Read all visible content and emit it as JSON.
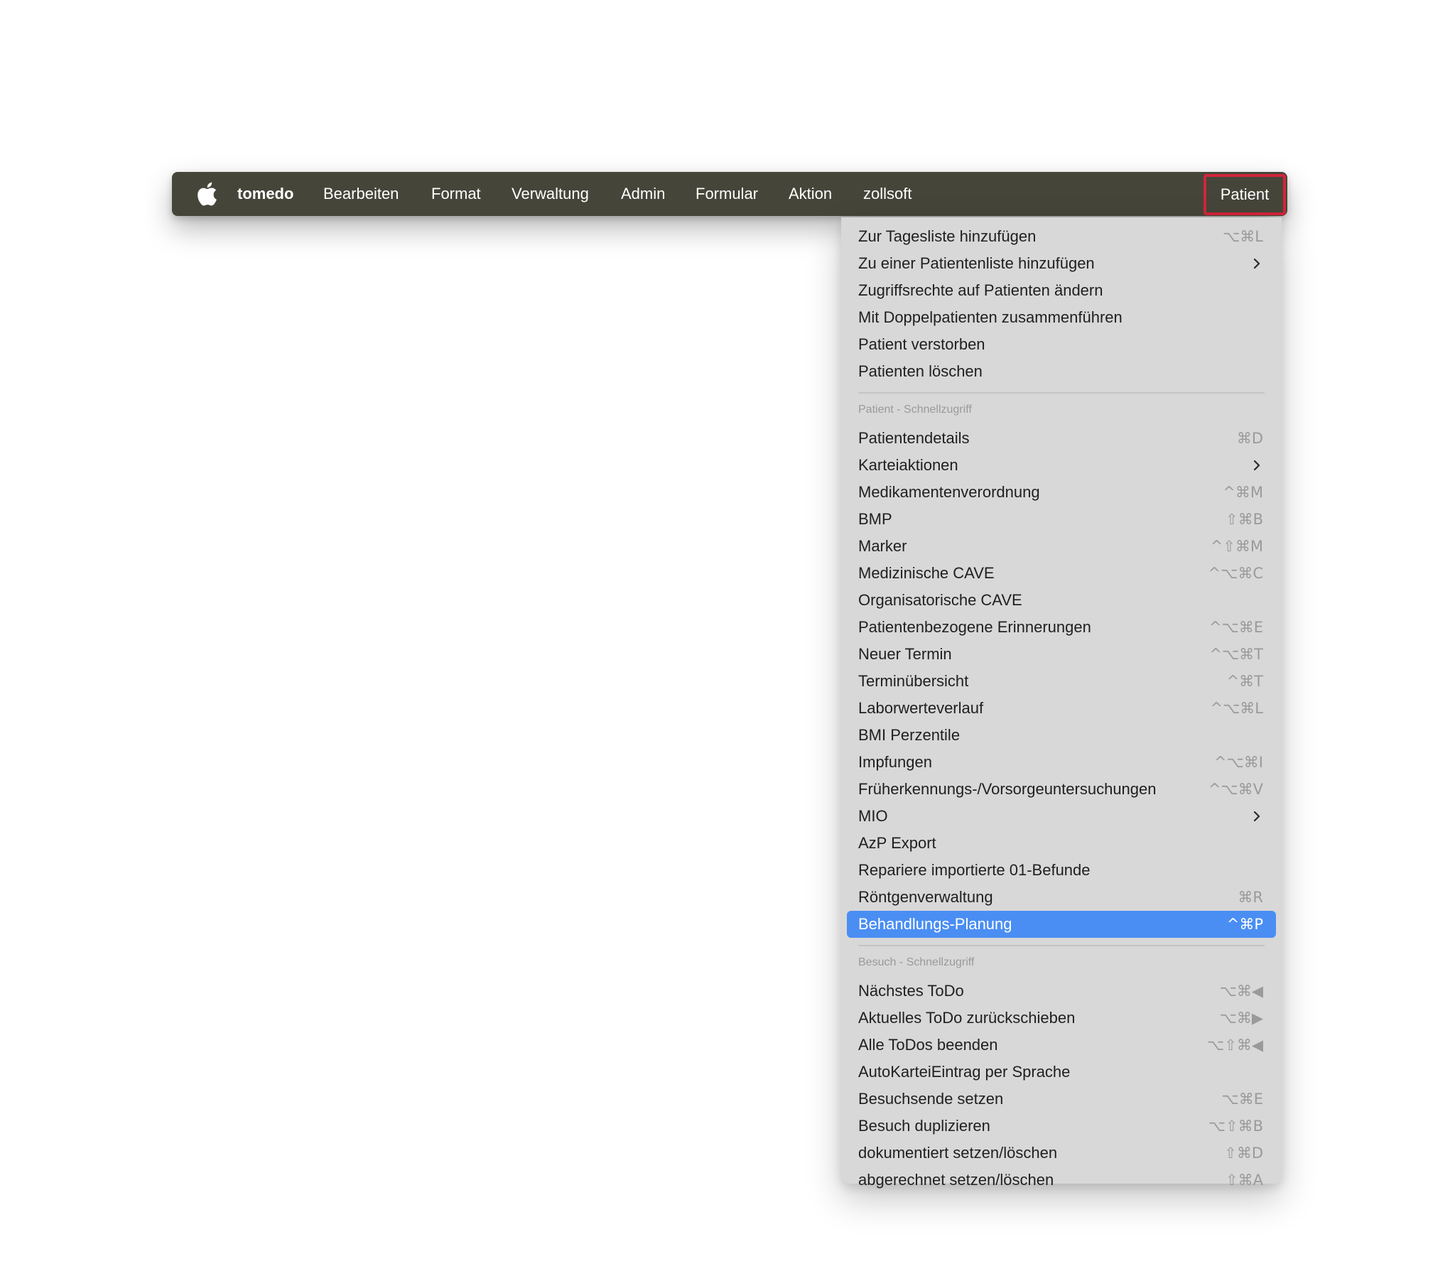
{
  "menubar": {
    "apple_icon": "apple-logo-icon",
    "items": [
      {
        "label": "tomedo"
      },
      {
        "label": "Bearbeiten"
      },
      {
        "label": "Format"
      },
      {
        "label": "Verwaltung"
      },
      {
        "label": "Admin"
      },
      {
        "label": "Formular"
      },
      {
        "label": "Aktion"
      },
      {
        "label": "zollsoft"
      },
      {
        "label": "Patient"
      }
    ],
    "active_item": "Patient",
    "highlight_color": "#d2253a"
  },
  "menu": {
    "selection_color": "#4a8ef3",
    "items": [
      {
        "label": "Zur Tagesliste hinzufügen",
        "shortcut": "⌥⌘L"
      },
      {
        "label": "Zu einer Patientenliste hinzufügen",
        "submenu": true
      },
      {
        "label": "Zugriffsrechte auf Patienten ändern"
      },
      {
        "label": "Mit Doppelpatienten zusammenführen"
      },
      {
        "label": "Patient verstorben"
      },
      {
        "label": "Patienten löschen"
      },
      {
        "label": "Patientendetails",
        "shortcut": "⌘D"
      },
      {
        "label": "Karteiaktionen",
        "submenu": true
      },
      {
        "label": "Medikamentenverordnung",
        "shortcut": "^⌘M"
      },
      {
        "label": "BMP",
        "shortcut": "⇧⌘B"
      },
      {
        "label": "Marker",
        "shortcut": "^⇧⌘M"
      },
      {
        "label": "Medizinische CAVE",
        "shortcut": "^⌥⌘C"
      },
      {
        "label": "Organisatorische CAVE"
      },
      {
        "label": "Patientenbezogene Erinnerungen",
        "shortcut": "^⌥⌘E"
      },
      {
        "label": "Neuer Termin",
        "shortcut": "^⌥⌘T"
      },
      {
        "label": "Terminübersicht",
        "shortcut": "^⌘T"
      },
      {
        "label": "Laborwerteverlauf",
        "shortcut": "^⌥⌘L"
      },
      {
        "label": "BMI Perzentile"
      },
      {
        "label": "Impfungen",
        "shortcut": "^⌥⌘I"
      },
      {
        "label": "Früherkennungs-/Vorsorgeuntersuchungen",
        "shortcut": "^⌥⌘V"
      },
      {
        "label": "MIO",
        "submenu": true
      },
      {
        "label": "AzP Export"
      },
      {
        "label": "Repariere importierte 01-Befunde"
      },
      {
        "label": "Röntgenverwaltung",
        "shortcut": "⌘R"
      },
      {
        "label": "Behandlungs-Planung",
        "shortcut": "^⌘P",
        "selected": true
      },
      {
        "label": "Nächstes ToDo",
        "shortcut": "⌥⌘◀"
      },
      {
        "label": "Aktuelles ToDo zurückschieben",
        "shortcut": "⌥⌘▶"
      },
      {
        "label": "Alle ToDos beenden",
        "shortcut": "⌥⇧⌘◀"
      },
      {
        "label": "AutoKarteiEintrag per Sprache"
      },
      {
        "label": "Besuchsende setzen",
        "shortcut": "⌥⌘E"
      },
      {
        "label": "Besuch duplizieren",
        "shortcut": "⌥⇧⌘B"
      },
      {
        "label": "dokumentiert setzen/löschen",
        "shortcut": "⇧⌘D"
      },
      {
        "label": "abgerechnet setzen/löschen",
        "shortcut": "⇧⌘A"
      }
    ],
    "section_headers": [
      {
        "label": "Patient - Schnellzugriff"
      },
      {
        "label": "Besuch - Schnellzugriff"
      }
    ]
  }
}
